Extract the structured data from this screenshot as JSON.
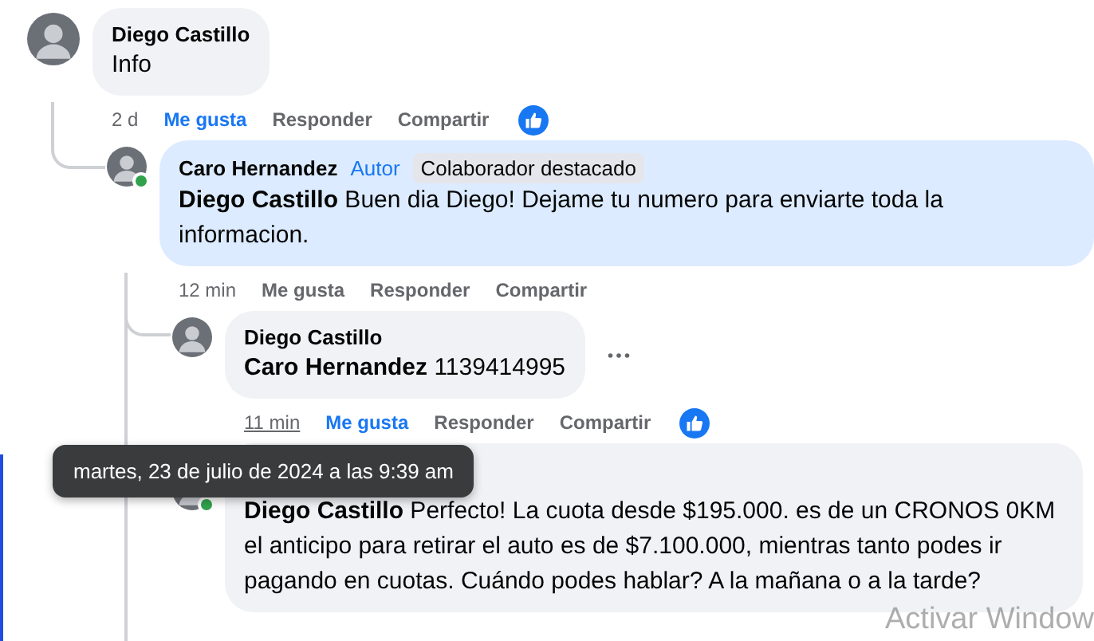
{
  "comments": [
    {
      "author": "Diego Castillo",
      "text": "Info",
      "highlighted": false,
      "time": "2 d",
      "time_hovered": false,
      "liked": true,
      "actions": [
        "Me gusta",
        "Responder",
        "Compartir"
      ],
      "replies": [
        {
          "author": "Caro Hernandez",
          "badges": [
            {
              "kind": "role",
              "label": "Autor"
            },
            {
              "kind": "tag",
              "label": "Colaborador destacado"
            }
          ],
          "text": "**Diego Castillo** Buen dia Diego! Dejame tu numero para enviarte toda la informacion.",
          "highlighted": true,
          "online": true,
          "time": "12 min",
          "time_hovered": false,
          "liked": false,
          "actions": [
            "Me gusta",
            "Responder",
            "Compartir"
          ],
          "replies": [
            {
              "author": "Diego Castillo",
              "text": "**Caro Hernandez** 1139414995",
              "highlighted": false,
              "time": "11 min",
              "time_hovered": true,
              "liked": true,
              "more_menu": true,
              "actions": [
                "Me gusta",
                "Responder",
                "Compartir"
              ]
            },
            {
              "text": "**Diego Castillo** Perfecto! La cuota desde $195.000. es de un CRONOS 0KM el anticipo para retirar el auto es de $7.100.000, mientras tanto podes ir pagando en cuotas. Cuándo podes hablar? A la mañana o a la tarde?",
              "highlighted": false,
              "online": true
            }
          ]
        }
      ]
    }
  ],
  "tooltip": {
    "text": "martes, 23 de julio de 2024 a las 9:39 am"
  },
  "system_notice": "Activar Window"
}
